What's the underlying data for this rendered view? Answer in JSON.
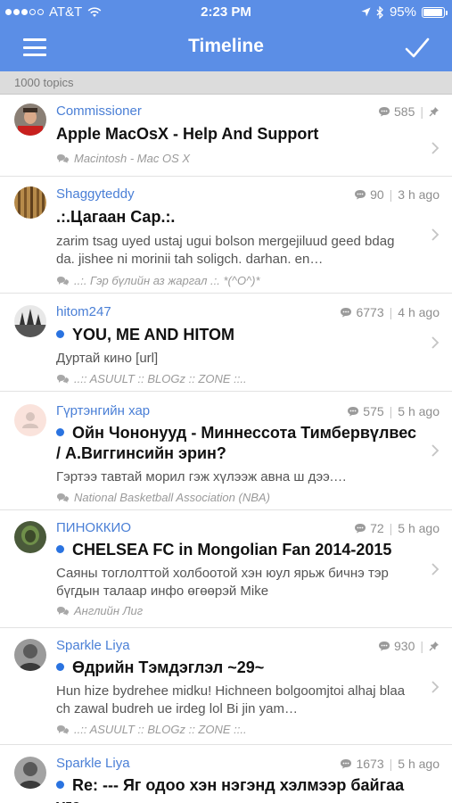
{
  "status_bar": {
    "carrier": "AT&T",
    "time": "2:23 PM",
    "battery": "95%",
    "battery_level": 0.95,
    "icons": [
      "signal-dots-icon",
      "wifi-icon",
      "location-arrow-icon",
      "bluetooth-icon",
      "battery-icon"
    ]
  },
  "nav": {
    "title": "Timeline",
    "left_icon": "hamburger-menu-icon",
    "right_icon": "checkmark-icon"
  },
  "topic_count": "1000 topics",
  "colors": {
    "accent": "#5b8ee6",
    "author": "#4a7fd6",
    "unread_dot": "#2a73e0"
  },
  "topics": [
    {
      "author": "Commissioner",
      "replies": "585",
      "time": "",
      "pinned": true,
      "unread": false,
      "title": "Apple MacOsX - Help And Support",
      "excerpt": "",
      "category": "Macintosh - Mac OS X"
    },
    {
      "author": "Shaggyteddy",
      "replies": "90",
      "time": "3 h ago",
      "pinned": false,
      "unread": false,
      "title": ".:.Цагаан Сар.:.",
      "excerpt": "zarim tsag uyed ustaj ugui bolson mergejiluud geed bdag da. jishee ni morinii tah soligch. darhan. en…",
      "category": "..:. Гэр бүлийн аз жаргал .:. *(^O^)*"
    },
    {
      "author": "hitom247",
      "replies": "6773",
      "time": "4 h ago",
      "pinned": false,
      "unread": true,
      "title": "YOU, ME AND HITOM",
      "excerpt": "Дуртай кино [url]",
      "category": "..:: ASUULT :: BLOGz :: ZONE ::.."
    },
    {
      "author": "Гүртэнгийн хар",
      "replies": "575",
      "time": "5 h ago",
      "pinned": false,
      "unread": true,
      "title": "Ойн Чононууд - Миннессота Тимбервүлвес / А.Виггинсийн эрин?",
      "excerpt": "Гэртээ тавтай морил гэж хүлээж авна ш дээ.…",
      "category": "National Basketball Association (NBA)"
    },
    {
      "author": "ПИНОККИО",
      "replies": "72",
      "time": "5 h ago",
      "pinned": false,
      "unread": true,
      "title": "CHELSEA FC in Mongolian Fan 2014-2015",
      "excerpt": "Саяны тоглолттой холбоотой хэн юул ярьж бичнэ тэр бүгдын талаар инфо өгөөрэй Mike",
      "category": "Английн Лиг"
    },
    {
      "author": "Sparkle Liya",
      "replies": "930",
      "time": "",
      "pinned": true,
      "unread": true,
      "title": "Өдрийн Тэмдэглэл ~29~",
      "excerpt": "Hun hize bydrehee midku! Hichneen bolgoomjtoi alhaj blaa ch zawal budreh ue irdeg lol Bi jin yam…",
      "category": "..:: ASUULT :: BLOGz :: ZONE ::.."
    },
    {
      "author": "Sparkle Liya",
      "replies": "1673",
      "time": "5 h ago",
      "pinned": false,
      "unread": true,
      "title": "Re: --- Яг одоо хэн нэгэнд хэлмээр байгаа үгс ---",
      "excerpt": "",
      "category": ""
    }
  ]
}
